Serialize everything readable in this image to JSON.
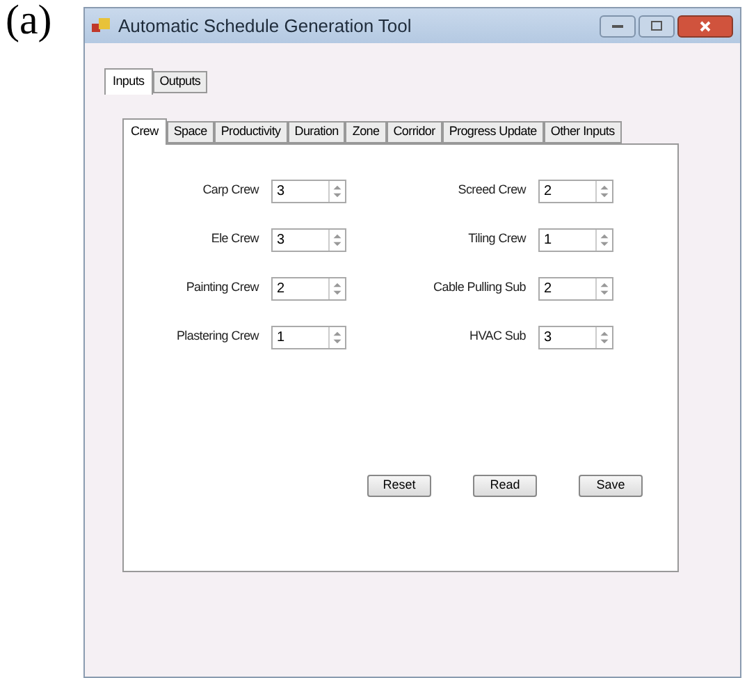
{
  "figure_label": "(a)",
  "window": {
    "title": "Automatic Schedule Generation Tool"
  },
  "outer_tabs": [
    {
      "label": "Inputs",
      "selected": true
    },
    {
      "label": "Outputs",
      "selected": false
    }
  ],
  "inner_tabs": [
    {
      "label": "Crew",
      "selected": true
    },
    {
      "label": "Space",
      "selected": false
    },
    {
      "label": "Productivity",
      "selected": false
    },
    {
      "label": "Duration",
      "selected": false
    },
    {
      "label": "Zone",
      "selected": false
    },
    {
      "label": "Corridor",
      "selected": false
    },
    {
      "label": "Progress Update",
      "selected": false
    },
    {
      "label": "Other Inputs",
      "selected": false
    }
  ],
  "left_fields": [
    {
      "label": "Carp Crew",
      "value": "3"
    },
    {
      "label": "Ele Crew",
      "value": "3"
    },
    {
      "label": "Painting Crew",
      "value": "2"
    },
    {
      "label": "Plastering Crew",
      "value": "1"
    }
  ],
  "right_fields": [
    {
      "label": "Screed Crew",
      "value": "2"
    },
    {
      "label": "Tiling Crew",
      "value": "1"
    },
    {
      "label": "Cable Pulling Sub",
      "value": "2"
    },
    {
      "label": "HVAC Sub",
      "value": "3"
    }
  ],
  "buttons": [
    "Reset",
    "Read",
    "Save"
  ]
}
